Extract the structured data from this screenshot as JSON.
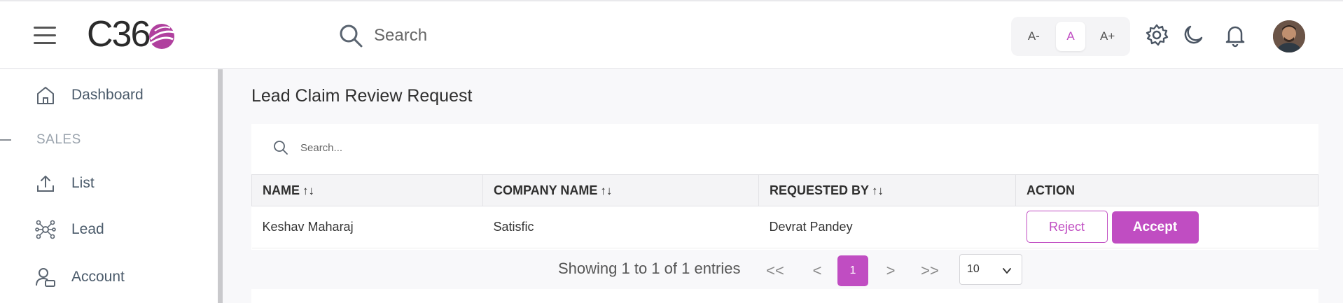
{
  "header": {
    "logo_text": "C36",
    "search_placeholder": "Search",
    "font_size": {
      "decrease": "A-",
      "normal": "A",
      "increase": "A+"
    }
  },
  "sidebar": {
    "items": [
      {
        "label": "Dashboard",
        "icon": "home-icon"
      },
      {
        "label": "List",
        "icon": "upload-icon"
      },
      {
        "label": "Lead",
        "icon": "network-icon"
      },
      {
        "label": "Account",
        "icon": "user-account-icon"
      }
    ],
    "section_label": "SALES"
  },
  "main": {
    "title": "Lead Claim Review Request",
    "search_placeholder": "Search...",
    "columns": [
      "NAME",
      "COMPANY NAME",
      "REQUESTED BY",
      "ACTION"
    ],
    "sort_glyph": "↑↓",
    "rows": [
      {
        "name": "Keshav Maharaj",
        "company": "Satisfic",
        "requested_by": "Devrat Pandey"
      }
    ],
    "actions": {
      "reject": "Reject",
      "accept": "Accept"
    },
    "pagination": {
      "info": "Showing 1 to 1 of 1 entries",
      "first": "<<",
      "prev": "<",
      "current_page": "1",
      "next": ">",
      "last": ">>",
      "page_size": "10"
    }
  },
  "colors": {
    "accent": "#c04dc2"
  }
}
